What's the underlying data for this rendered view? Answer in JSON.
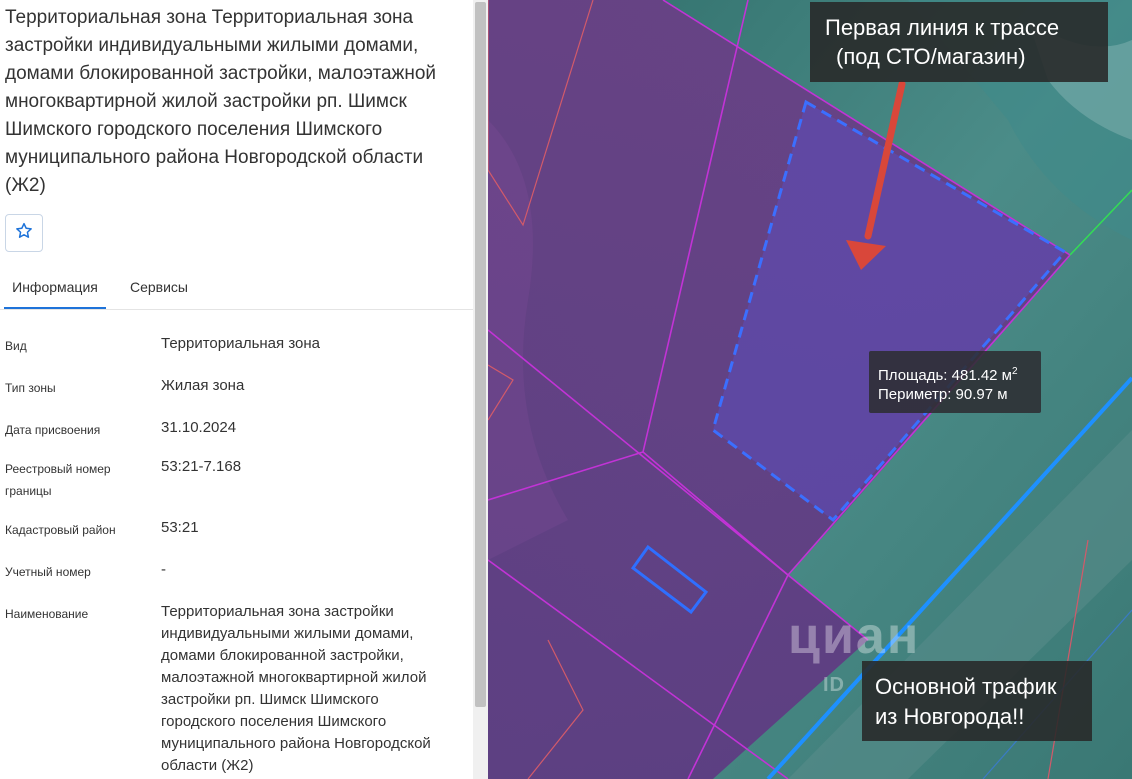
{
  "panel": {
    "title": "Территориальная зона Территориальная зона застройки индивидуальными жилыми домами, домами блокированной застройки, малоэтажной многоквартирной жилой застройки рп. Шимск Шимского городского поселения Шимского муниципального района Новгородской области (Ж2)",
    "favorite_icon": "star-outline-icon",
    "tabs": [
      {
        "label": "Информация",
        "active": true
      },
      {
        "label": "Сервисы",
        "active": false
      }
    ],
    "rows": [
      {
        "label": "Вид",
        "value": "Территориальная зона"
      },
      {
        "label": "Тип зоны",
        "value": "Жилая зона"
      },
      {
        "label": "Дата присвоения",
        "value": "31.10.2024"
      },
      {
        "label": "Реестровый номер границы",
        "value": "53:21-7.168"
      },
      {
        "label": "Кадастровый район",
        "value": "53:21"
      },
      {
        "label": "Учетный номер",
        "value": "-"
      },
      {
        "label": "Наименование",
        "value": "Территориальная зона застройки индивидуальными жилыми домами, домами блокированной застройки, малоэтажной многоквартирной жилой застройки рп. Шимск Шимского городского поселения Шимского муниципального района Новгородской области (Ж2)"
      }
    ]
  },
  "map": {
    "callout_top": {
      "line1": "Первая линия к трассе",
      "line2": "(под СТО/магазин)"
    },
    "callout_bottom": {
      "line1": "Основной трафик",
      "line2": "из Новгорода!!"
    },
    "measure": {
      "area_text": "Площадь: 481.42 м",
      "area_unit_sup": "2",
      "perimeter_text": "Периметр: 90.97 м"
    },
    "watermark": {
      "brand": "циан",
      "sub": "ID"
    },
    "colors": {
      "zone_fill": "#6a3a8c",
      "zone_border": "#c233d6",
      "selection": "#3b6fff",
      "road": "#1e90ff",
      "arrow": "#d9473a",
      "callout_bg": "#282828"
    }
  }
}
